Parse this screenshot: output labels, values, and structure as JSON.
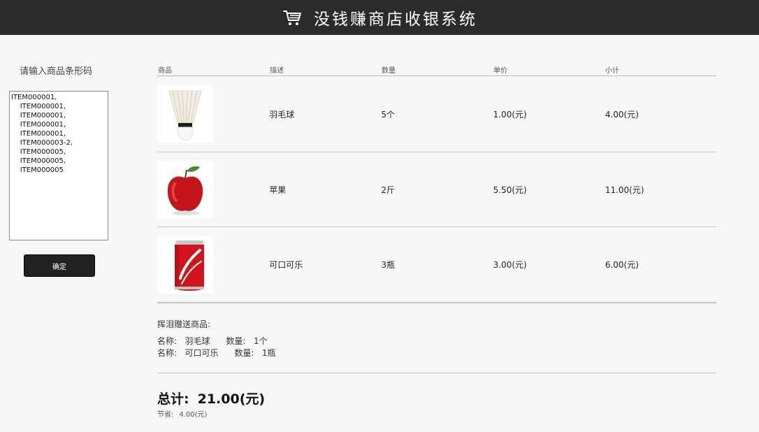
{
  "header": {
    "icon": "shopping-cart-icon",
    "title": "没钱赚商店收银系统"
  },
  "input_panel": {
    "label": "请输入商品条形码",
    "barcodes_text": "ITEM000001,\n    ITEM000001,\n    ITEM000001,\n    ITEM000001,\n    ITEM000001,\n    ITEM000003-2,\n    ITEM000005,\n    ITEM000005,\n    ITEM000005",
    "confirm_label": "确定"
  },
  "table": {
    "headers": [
      "商品",
      "描述",
      "数量",
      "单价",
      "小计"
    ],
    "rows": [
      {
        "image": "shuttlecock-image",
        "desc": "羽毛球",
        "qty": "5个",
        "price": "1.00(元)",
        "subtotal": "4.00(元)"
      },
      {
        "image": "apple-image",
        "desc": "苹果",
        "qty": "2斤",
        "price": "5.50(元)",
        "subtotal": "11.00(元)"
      },
      {
        "image": "cola-can-image",
        "desc": "可口可乐",
        "qty": "3瓶",
        "price": "3.00(元)",
        "subtotal": "6.00(元)"
      }
    ]
  },
  "gifts": {
    "title": "挥泪赠送商品:",
    "items": [
      {
        "name_label": "名称:",
        "name": "羽毛球",
        "qty_label": "数量:",
        "qty": "1个"
      },
      {
        "name_label": "名称:",
        "name": "可口可乐",
        "qty_label": "数量:",
        "qty": "1瓶"
      }
    ]
  },
  "summary": {
    "total_label": "总计:",
    "total_value": "21.00(元)",
    "saved_label": "节省:",
    "saved_value": "4.00(元)"
  }
}
